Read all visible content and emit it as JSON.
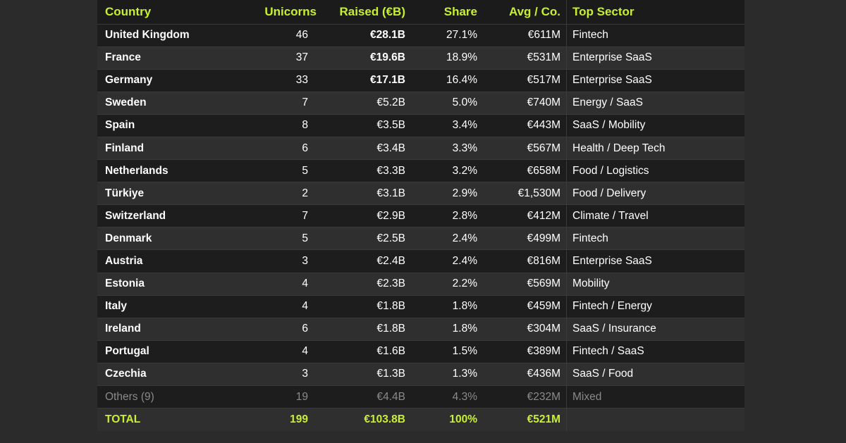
{
  "headers": {
    "country": "Country",
    "unicorns": "Unicorns",
    "raised": "Raised (€B)",
    "share": "Share",
    "avg": "Avg / Co.",
    "sector": "Top Sector"
  },
  "rows": [
    {
      "country": "United Kingdom",
      "unicorns": "46",
      "raised": "€28.1B",
      "share": "27.1%",
      "avg": "€611M",
      "sector": "Fintech"
    },
    {
      "country": "France",
      "unicorns": "37",
      "raised": "€19.6B",
      "share": "18.9%",
      "avg": "€531M",
      "sector": "Enterprise SaaS"
    },
    {
      "country": "Germany",
      "unicorns": "33",
      "raised": "€17.1B",
      "share": "16.4%",
      "avg": "€517M",
      "sector": "Enterprise SaaS"
    },
    {
      "country": "Sweden",
      "unicorns": "7",
      "raised": "€5.2B",
      "share": "5.0%",
      "avg": "€740M",
      "sector": "Energy / SaaS"
    },
    {
      "country": "Spain",
      "unicorns": "8",
      "raised": "€3.5B",
      "share": "3.4%",
      "avg": "€443M",
      "sector": "SaaS / Mobility"
    },
    {
      "country": "Finland",
      "unicorns": "6",
      "raised": "€3.4B",
      "share": "3.3%",
      "avg": "€567M",
      "sector": "Health / Deep Tech"
    },
    {
      "country": "Netherlands",
      "unicorns": "5",
      "raised": "€3.3B",
      "share": "3.2%",
      "avg": "€658M",
      "sector": "Food / Logistics"
    },
    {
      "country": "Türkiye",
      "unicorns": "2",
      "raised": "€3.1B",
      "share": "2.9%",
      "avg": "€1,530M",
      "sector": "Food / Delivery"
    },
    {
      "country": "Switzerland",
      "unicorns": "7",
      "raised": "€2.9B",
      "share": "2.8%",
      "avg": "€412M",
      "sector": "Climate / Travel"
    },
    {
      "country": "Denmark",
      "unicorns": "5",
      "raised": "€2.5B",
      "share": "2.4%",
      "avg": "€499M",
      "sector": "Fintech"
    },
    {
      "country": "Austria",
      "unicorns": "3",
      "raised": "€2.4B",
      "share": "2.4%",
      "avg": "€816M",
      "sector": "Enterprise SaaS"
    },
    {
      "country": "Estonia",
      "unicorns": "4",
      "raised": "€2.3B",
      "share": "2.2%",
      "avg": "€569M",
      "sector": "Mobility"
    },
    {
      "country": "Italy",
      "unicorns": "4",
      "raised": "€1.8B",
      "share": "1.8%",
      "avg": "€459M",
      "sector": "Fintech / Energy"
    },
    {
      "country": "Ireland",
      "unicorns": "6",
      "raised": "€1.8B",
      "share": "1.8%",
      "avg": "€304M",
      "sector": "SaaS / Insurance"
    },
    {
      "country": "Portugal",
      "unicorns": "4",
      "raised": "€1.6B",
      "share": "1.5%",
      "avg": "€389M",
      "sector": "Fintech / SaaS"
    },
    {
      "country": "Czechia",
      "unicorns": "3",
      "raised": "€1.3B",
      "share": "1.3%",
      "avg": "€436M",
      "sector": "SaaS / Food"
    },
    {
      "country": "Others (9)",
      "unicorns": "19",
      "raised": "€4.4B",
      "share": "4.3%",
      "avg": "€232M",
      "sector": "Mixed"
    },
    {
      "country": "TOTAL",
      "unicorns": "199",
      "raised": "€103.8B",
      "share": "100%",
      "avg": "€521M",
      "sector": ""
    }
  ],
  "colors": {
    "accent": "#c8f031",
    "header_bg": "#1b1b1b",
    "row_dark": "#1d1d1d",
    "row_light": "#2f2f2f",
    "muted_text": "#8a8a8a",
    "page_bg": "#2b2b2b"
  }
}
